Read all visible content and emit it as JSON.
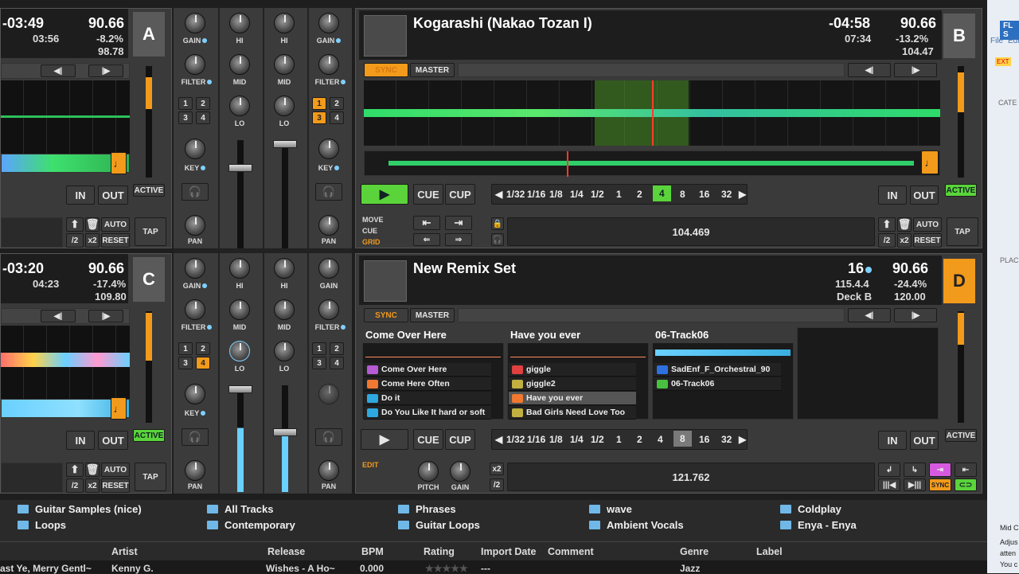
{
  "deckA": {
    "time": "-03:49",
    "elapsed": "03:56",
    "bpm": "90.66",
    "pitch": "-8.2%",
    "tempo": "98.78",
    "letter": "A"
  },
  "deckB": {
    "title": "Kogarashi (Nakao Tozan I)",
    "time": "-04:58",
    "elapsed": "07:34",
    "bpm": "90.66",
    "pitch": "-13.2%",
    "tempo": "104.47",
    "letter": "B",
    "sync": "SYNC",
    "master": "MASTER",
    "play": "▶",
    "cue": "CUE",
    "cup": "CUP",
    "in": "IN",
    "out": "OUT",
    "active": "ACTIVE",
    "auto": "AUTO",
    "reset": "RESET",
    "tap": "TAP",
    "half": "/2",
    "x2": "x2",
    "move": "MOVE",
    "cue_lbl": "CUE",
    "grid": "GRID",
    "beatpos": "104.469"
  },
  "deckC": {
    "time": "-03:20",
    "elapsed": "04:23",
    "bpm": "90.66",
    "pitch": "-17.4%",
    "tempo": "109.80",
    "letter": "C"
  },
  "deckD": {
    "title": "New Remix Set",
    "beats": "16",
    "bar": "115.4.4",
    "deckb": "Deck B",
    "bpm": "90.66",
    "pitch": "-24.4%",
    "tempo": "120.00",
    "letter": "D",
    "sync": "SYNC",
    "master": "MASTER",
    "play": "▶",
    "cue": "CUE",
    "cup": "CUP",
    "edit": "EDIT",
    "pitch_lbl": "PITCH",
    "gain_lbl": "GAIN",
    "x2": "x2",
    "half": "/2",
    "beatpos": "121.762",
    "in": "IN",
    "out": "OUT",
    "active": "ACTIVE",
    "slots": [
      {
        "title": "Come Over Here",
        "items": [
          "Come Over Here",
          "Come Here Often",
          "Do it",
          "Do You Like It hard or soft"
        ]
      },
      {
        "title": "Have you ever",
        "items": [
          "giggle",
          "giggle2",
          "Have you ever",
          "Bad Girls Need Love Too"
        ]
      },
      {
        "title": "06-Track06",
        "items": [
          "SadEnf_F_Orchestral_90",
          "06-Track06"
        ]
      }
    ]
  },
  "loops": [
    "1/32",
    "1/16",
    "1/8",
    "1/4",
    "1/2",
    "1",
    "2",
    "4",
    "8",
    "16",
    "32"
  ],
  "common": {
    "in": "IN",
    "out": "OUT",
    "active": "ACTIVE",
    "auto": "AUTO",
    "reset": "RESET",
    "tap": "TAP",
    "half": "/2",
    "x2": "x2"
  },
  "mixer": {
    "gain": "GAIN",
    "hi": "HI",
    "mid": "MID",
    "lo": "LO",
    "filter": "FILTER",
    "key": "KEY",
    "pan": "PAN",
    "n1": "1",
    "n2": "2",
    "n3": "3",
    "n4": "4"
  },
  "folders": [
    "Guitar Samples (nice)",
    "Loops",
    "All Tracks",
    "Contemporary",
    "Phrases",
    "Guitar Loops",
    "wave",
    "Ambient Vocals",
    "Coldplay",
    "Enya - Enya"
  ],
  "columns": [
    "Artist",
    "Release",
    "BPM",
    "Rating",
    "Import Date",
    "Comment",
    "Genre",
    "Label"
  ],
  "row": {
    "title": "ast Ye, Merry Gentl~",
    "artist": "Kenny G.",
    "release": "Wishes - A Ho~",
    "bpm": "0.000",
    "date": "---",
    "genre": "Jazz"
  },
  "side": {
    "top": "FL S",
    "file": "File",
    "edit": "Edit",
    "ext": "EXT",
    "cate": "CATE",
    "plac": "PLAC",
    "mid": "Mid C",
    "adju": "Adjus",
    "atten": "atten",
    "you": "You c"
  }
}
